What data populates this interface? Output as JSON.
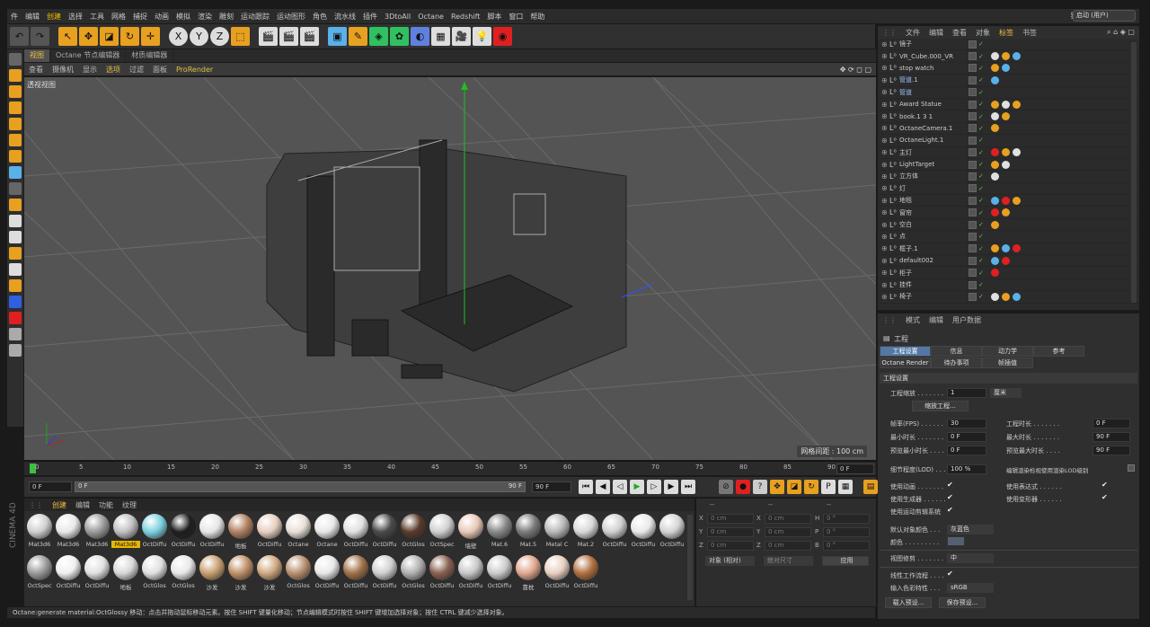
{
  "menubar": {
    "items": [
      "件",
      "编辑",
      "创建",
      "选择",
      "工具",
      "网格",
      "捕捉",
      "动画",
      "模拟",
      "渲染",
      "雕刻",
      "运动跟踪",
      "运动图形",
      "角色",
      "流水线",
      "插件",
      "3DtoAll",
      "Octane",
      "Redshift",
      "脚本",
      "窗口",
      "帮助"
    ],
    "layout_label": "界面:",
    "layout_value": "启动 (用户)"
  },
  "viewport": {
    "tabs": [
      "视图",
      "Octane 节点编辑器",
      "材质编辑器"
    ],
    "menu": [
      "查看",
      "摄像机",
      "显示",
      "选项",
      "过滤",
      "面板",
      "ProRender"
    ],
    "label": "透视视图",
    "grid_info": "网格间距 : 100 cm"
  },
  "timeline": {
    "ticks": [
      "0",
      "5",
      "10",
      "15",
      "20",
      "25",
      "30",
      "35",
      "40",
      "45",
      "50",
      "55",
      "60",
      "65",
      "70",
      "75",
      "80",
      "85",
      "90"
    ],
    "current": "0 F",
    "start": "0 F",
    "slider_start": "0 F",
    "slider_end": "90 F",
    "end": "90 F"
  },
  "materials": {
    "tabs": [
      "创建",
      "编辑",
      "功能",
      "纹理"
    ],
    "items": [
      {
        "label": "Mat3d6",
        "color": "#cfcfcf"
      },
      {
        "label": "Mat3d6",
        "color": "#e8e8e8"
      },
      {
        "label": "Mat3d6",
        "color": "#9a9a9a"
      },
      {
        "label": "Mat3d6",
        "color": "#c0c0c0",
        "selected": true
      },
      {
        "label": "OctDiffu",
        "color": "#7dd0e0"
      },
      {
        "label": "OctDiffu",
        "color": "#1e1e1e"
      },
      {
        "label": "OctDiffu",
        "color": "#e6e6e6"
      },
      {
        "label": "地板",
        "color": "#b08060"
      },
      {
        "label": "OctDiffu",
        "color": "#e6cfc0"
      },
      {
        "label": "Octane",
        "color": "#e8e0d8"
      },
      {
        "label": "Octane",
        "color": "#e8e8e8"
      },
      {
        "label": "OctDiffu",
        "color": "#e0e0e0"
      },
      {
        "label": "OctDiffu",
        "color": "#4a4a4a"
      },
      {
        "label": "OctGlos",
        "color": "#5a3a2a"
      },
      {
        "label": "OctSpec",
        "color": "#d0d0d0"
      },
      {
        "label": "墙壁",
        "color": "#e8c8b8"
      },
      {
        "label": "Mat.6",
        "color": "#888888"
      },
      {
        "label": "Mat.5",
        "color": "#7a7a7a"
      },
      {
        "label": "Metal C",
        "color": "#b8b8b8"
      },
      {
        "label": "Mat.2",
        "color": "#d8d8d8"
      },
      {
        "label": "OctDiffu",
        "color": "#d0d0d0"
      },
      {
        "label": "OctDiffu",
        "color": "#e8e8e8"
      },
      {
        "label": "OctDiffu",
        "color": "#d4d4d4"
      },
      {
        "label": "OctSpec",
        "color": "#9a9a9a"
      },
      {
        "label": "OctDiffu",
        "color": "#f0f0f0"
      },
      {
        "label": "OctDiffu",
        "color": "#e0e0e0"
      },
      {
        "label": "地板",
        "color": "#d8d8d8"
      },
      {
        "label": "OctGlos",
        "color": "#e0e0e0"
      },
      {
        "label": "OctGlos",
        "color": "#e8e8e8"
      },
      {
        "label": "沙发",
        "color": "#c8a070"
      },
      {
        "label": "沙发",
        "color": "#c09068"
      },
      {
        "label": "沙发",
        "color": "#d0a880"
      },
      {
        "label": "OctGlos",
        "color": "#b89070"
      },
      {
        "label": "OctDiffu",
        "color": "#e8e8e8"
      },
      {
        "label": "OctDiffu",
        "color": "#a07048"
      },
      {
        "label": "OctDiffu",
        "color": "#d0d0d0"
      },
      {
        "label": "OctGlos",
        "color": "#b0b0b0"
      },
      {
        "label": "OctDiffu",
        "color": "#886050"
      },
      {
        "label": "OctDiffu",
        "color": "#c8c8c8"
      },
      {
        "label": "OctDiffu",
        "color": "#cccccc"
      },
      {
        "label": "靠枕",
        "color": "#e0a890"
      },
      {
        "label": "OctDiffu",
        "color": "#e8d0c0"
      },
      {
        "label": "OctDiffu",
        "color": "#b07040"
      }
    ]
  },
  "coords": {
    "header": [
      "--",
      "--",
      "--"
    ],
    "rows": [
      {
        "a": "X",
        "av": "0 cm",
        "b": "X",
        "bv": "0 cm",
        "c": "H",
        "cv": "0 °"
      },
      {
        "a": "Y",
        "av": "0 cm",
        "b": "Y",
        "bv": "0 cm",
        "c": "P",
        "cv": "0 °"
      },
      {
        "a": "Z",
        "av": "0 cm",
        "b": "Z",
        "bv": "0 cm",
        "c": "B",
        "cv": "0 °"
      }
    ],
    "mode": "对象 (相对)",
    "size_mode": "绝对尺寸",
    "apply": "应用"
  },
  "object_manager": {
    "tabs": [
      "文件",
      "编辑",
      "查看",
      "对象",
      "标签",
      "书签"
    ],
    "objects": [
      {
        "name": "镜子",
        "blue": false
      },
      {
        "name": "VR_Cube.000_VR",
        "blue": false
      },
      {
        "name": "stop watch",
        "blue": false
      },
      {
        "name": "管道.1",
        "blue": true
      },
      {
        "name": "管道",
        "blue": true
      },
      {
        "name": "Award Statue",
        "blue": false
      },
      {
        "name": "book.1 3 1",
        "blue": false
      },
      {
        "name": "OctaneCamera.1",
        "blue": false
      },
      {
        "name": "OctaneLight.1",
        "blue": false
      },
      {
        "name": "主灯",
        "blue": false
      },
      {
        "name": "LightTarget",
        "blue": false
      },
      {
        "name": "立方体",
        "blue": false
      },
      {
        "name": "灯",
        "blue": false
      },
      {
        "name": "地毯",
        "blue": false
      },
      {
        "name": "窗帘",
        "blue": false
      },
      {
        "name": "空白",
        "blue": false
      },
      {
        "name": "点",
        "blue": false
      },
      {
        "name": "框子.1",
        "blue": false
      },
      {
        "name": "default002",
        "blue": false
      },
      {
        "name": "柜子",
        "blue": false
      },
      {
        "name": "挂件",
        "blue": false
      },
      {
        "name": "椅子",
        "blue": false
      }
    ]
  },
  "attributes": {
    "menu": [
      "模式",
      "编辑",
      "用户数据"
    ],
    "title": "工程",
    "tabs_row1": [
      "工程设置",
      "信息",
      "动力学",
      "参考"
    ],
    "tabs_row2": [
      "Octane Render",
      "待办事项",
      "帧插值"
    ],
    "section": "工程设置",
    "scale_label": "工程缩放 . . . . . . .",
    "scale_value": "1",
    "scale_unit": "厘米",
    "scale_button": "缩放工程...",
    "fps_label": "帧率(FPS) . . . . . .",
    "fps": "30",
    "duration_label": "工程时长 . . . . . . .",
    "duration": "0 F",
    "min_label": "最小时长 . . . . . . .",
    "min": "0 F",
    "max_label": "最大时长 . . . . . . .",
    "max": "90 F",
    "pmin_label": "预览最小时长 . . . .",
    "pmin": "0 F",
    "pmax_label": "预览最大时长 . . . .",
    "pmax": "90 F",
    "lod_label": "细节程度(LOD) . . .",
    "lod": "100 %",
    "render_lod_label": "编辑渲染检视使用渲染LOD级别",
    "use_anim": "使用动画 . . . . . . .",
    "use_expr": "使用表达式 . . . . . .",
    "use_gen": "使用生成器 . . . . . .",
    "use_deform": "使用变形器 . . . . . .",
    "use_motion": "使用运动剪辑系统",
    "obj_color_label": "默认对象颜色 . . .",
    "obj_color": "灰蓝色",
    "color_label": "颜色 . . . . . . . . .",
    "view_clip_label": "视图修剪 . . . . . . .",
    "view_clip": "中",
    "linear_label": "线性工作流程 . . . .",
    "input_color_label": "输入色彩特性 . . .",
    "input_color": "sRGB",
    "load_preset": "载入预设...",
    "save_preset": "保存预设..."
  },
  "status": "Octane:generate material:OctGlossy  移动：点击并拖动鼠标移动元素。按住 SHIFT 键量化移动；节点编辑模式时按住 SHIFT 键增加选择对象；按住 CTRL 键减少选择对象。",
  "brand": "CINEMA 4D"
}
